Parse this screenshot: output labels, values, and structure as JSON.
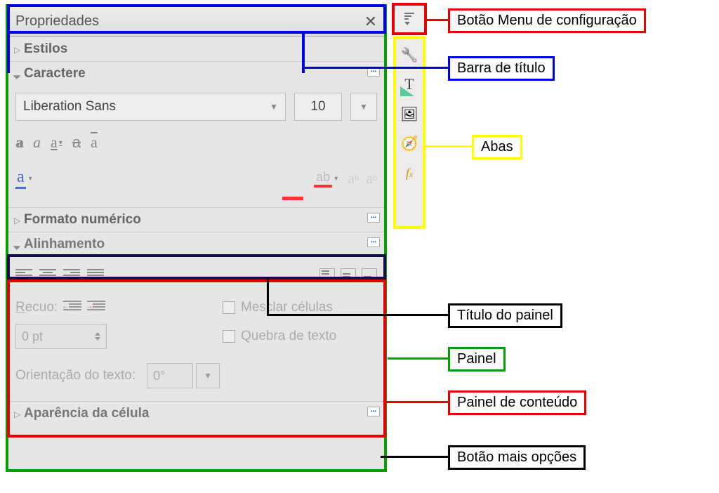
{
  "titlebar": {
    "title": "Propriedades"
  },
  "sections": {
    "estilos": "Estilos",
    "caractere": "Caractere",
    "formato_numerico": "Formato numérico",
    "alinhamento": "Alinhamento",
    "aparencia": "Aparência da célula"
  },
  "character": {
    "font_name": "Liberation Sans",
    "font_size": "10"
  },
  "alignment": {
    "recuo_label": "Recuo:",
    "recuo_value": "0 pt",
    "merge_label": "Mesclar células",
    "wrap_label": "Quebra de texto",
    "orient_label": "Orientação do texto:",
    "orient_value": "0°"
  },
  "annotations": {
    "menu": "Botão Menu de configuração",
    "titlebar": "Barra de título",
    "tabs": "Abas",
    "panel_title": "Título do painel",
    "panel": "Painel",
    "content_panel": "Painel de conteúdo",
    "more_button": "Botão mais opções"
  }
}
